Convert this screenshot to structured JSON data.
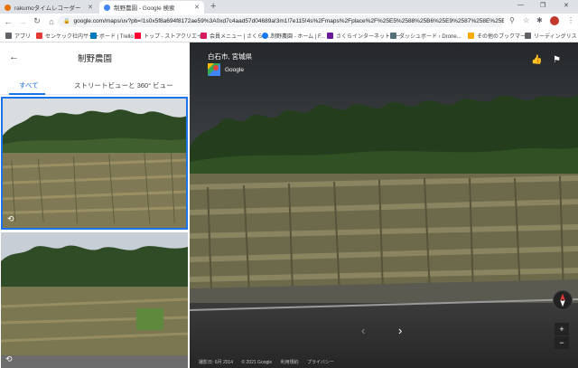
{
  "browser": {
    "tabs": [
      {
        "label": "rakumoタイムレコーダー",
        "active": false,
        "color": "#e8710a"
      },
      {
        "label": "制野農園 - Google 検索",
        "active": true,
        "color": "#4285f4"
      }
    ],
    "new_tab": "+",
    "window_controls": {
      "minimize": "—",
      "maximize": "❐",
      "close": "✕"
    },
    "url": "google.com/maps/uv?pb=!1s0x5f8a694f8172ae59%3A0xd7c4aad57d04689a!3m1!7e115!4s%2Fmaps%2Fplace%2F%25E5%2588%25B6%25E9%2587%258E%25E8%25BE%25B2%25E5%259C%2592"
  },
  "bookmarks": [
    {
      "label": "アプリ",
      "color": "#5f6368"
    },
    {
      "label": "センケック社内サイト",
      "color": "#e53935"
    },
    {
      "label": "ボード | Trello",
      "color": "#0079bf"
    },
    {
      "label": "トップ - ストアクリエイ...",
      "color": "#ff0033"
    },
    {
      "label": "会員メニュー | さくらイ...",
      "color": "#d81b60"
    },
    {
      "label": "制野農園 - ホーム | F...",
      "color": "#1877f2"
    },
    {
      "label": "さくらインターネットサー...",
      "color": "#6a1b9a"
    },
    {
      "label": "ダッシュボード ‹ Drone...",
      "color": "#546e7a"
    },
    {
      "label": "その他のブックマーク",
      "color": "#f9ab00"
    },
    {
      "label": "リーディングリスト",
      "color": "#5f6368"
    }
  ],
  "panel": {
    "title": "制野農園",
    "tabs": [
      {
        "label": "すべて",
        "selected": true
      },
      {
        "label": "ストリートビューと 360° ビュー",
        "selected": false
      }
    ]
  },
  "streetview": {
    "location_title": "白石市, 宮城県",
    "brand": "Google",
    "footer": [
      "撮影日: 6月 2014",
      "© 2021 Google",
      "利用規約",
      "プライバシー"
    ],
    "zoom_in": "+",
    "zoom_out": "−"
  },
  "colors": {
    "accent": "#1a73e8",
    "panel_bg": "#ffffff",
    "map_bg": "#202124"
  }
}
